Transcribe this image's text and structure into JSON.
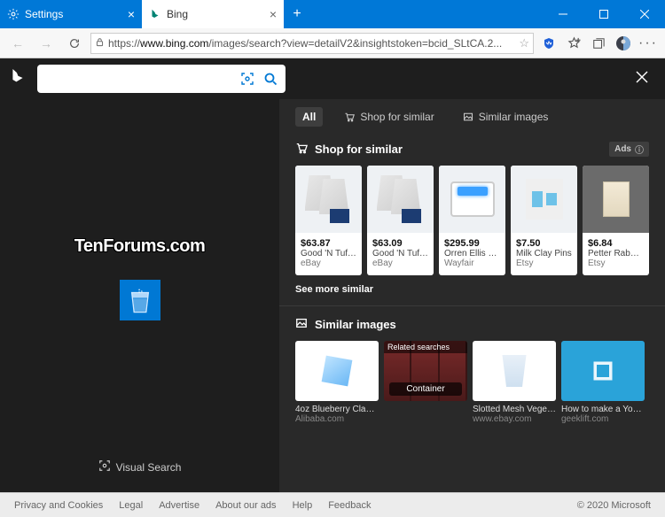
{
  "browser": {
    "tabs": [
      {
        "label": "Settings",
        "icon": "gear"
      },
      {
        "label": "Bing",
        "icon": "bing"
      }
    ],
    "url_domain": "www.bing.com",
    "url_prefix": "https://",
    "url_path": "/images/search?view=detailV2&insightstoken=bcid_SLtCA.2..."
  },
  "search": {
    "value": ""
  },
  "watermark": "TenForums.com",
  "visual_search_label": "Visual Search",
  "tabs": {
    "all": "All",
    "shop": "Shop for similar",
    "similar": "Similar images"
  },
  "shop": {
    "heading": "Shop for similar",
    "ads_label": "Ads",
    "see_more": "See more similar",
    "items": [
      {
        "price": "$63.87",
        "title": "Good 'N Tuff ...",
        "source": "eBay"
      },
      {
        "price": "$63.09",
        "title": "Good 'N Tuff ...",
        "source": "eBay"
      },
      {
        "price": "$295.99",
        "title": "Orren Ellis C...",
        "source": "Wayfair"
      },
      {
        "price": "$7.50",
        "title": "Milk Clay Pins",
        "source": "Etsy"
      },
      {
        "price": "$6.84",
        "title": "Petter Rabbit...",
        "source": "Etsy"
      }
    ]
  },
  "similar": {
    "heading": "Similar images",
    "related_label": "Related searches",
    "related_tag": "Container",
    "items": [
      {
        "title": "4oz Blueberry Clamsh...",
        "source": "Alibaba.com"
      },
      {
        "title": "",
        "source": ""
      },
      {
        "title": "Slotted Mesh Vegetab...",
        "source": "www.ebay.com"
      },
      {
        "title": "How to make a YouTu...",
        "source": "geeklift.com"
      }
    ]
  },
  "footer": {
    "links": [
      "Privacy and Cookies",
      "Legal",
      "Advertise",
      "About our ads",
      "Help",
      "Feedback"
    ],
    "copyright": "© 2020 Microsoft"
  }
}
